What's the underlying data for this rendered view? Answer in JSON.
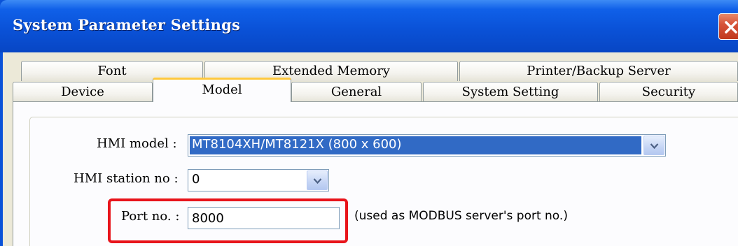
{
  "window": {
    "title": "System Parameter Settings",
    "close_icon": "close-icon",
    "colors": {
      "titlebar": "#0a52d8",
      "close": "#c13a1e",
      "highlight": "#e8141b",
      "active_tab_accent": "#ffc83c"
    }
  },
  "tabs": {
    "row1": [
      {
        "label": "Font"
      },
      {
        "label": "Extended Memory"
      },
      {
        "label": "Printer/Backup Server"
      }
    ],
    "row2": [
      {
        "label": "Device"
      },
      {
        "label": "Model",
        "active": true
      },
      {
        "label": "General"
      },
      {
        "label": "System Setting"
      },
      {
        "label": "Security"
      }
    ]
  },
  "form": {
    "hmi_model": {
      "label": "HMI model :",
      "value": "MT8104XH/MT8121X (800 x 600)",
      "icon": "chevron-down-icon"
    },
    "hmi_station": {
      "label": "HMI station no :",
      "value": "0",
      "icon": "chevron-down-icon"
    },
    "port": {
      "label": "Port no. :",
      "value": "8000",
      "note": "(used as MODBUS server's port no.)"
    }
  }
}
